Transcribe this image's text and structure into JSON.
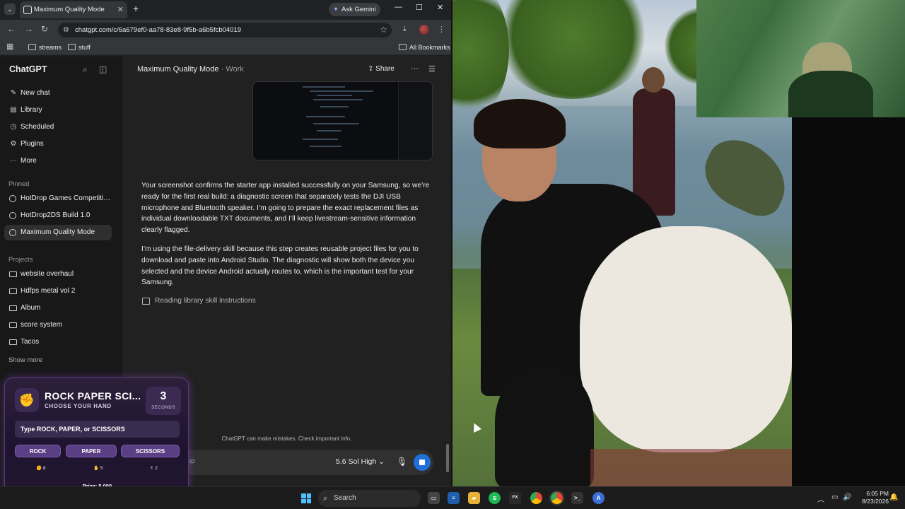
{
  "browser": {
    "tab_title": "Maximum Quality Mode",
    "gemini_label": "Ask Gemini",
    "url": "chatgpt.com/c/6a679ef0-aa78-83e8-9f5b-a6b5fcb04019",
    "bookmarks": [
      "streams",
      "stuff"
    ],
    "all_bookmarks": "All Bookmarks"
  },
  "sidebar": {
    "brand": "ChatGPT",
    "nav": [
      "New chat",
      "Library",
      "Scheduled",
      "Plugins",
      "More"
    ],
    "pinned_heading": "Pinned",
    "pinned": [
      "HotDrop Games Competitio...",
      "HotDrop2DS Build 1.0",
      "Maximum Quality Mode"
    ],
    "projects_heading": "Projects",
    "projects": [
      "website overhaul",
      "Hdfps metal vol 2",
      "Album",
      "score system",
      "Tacos"
    ],
    "show_more": "Show more"
  },
  "chat": {
    "title": "Maximum Quality Mode",
    "separator": "·",
    "project": "Work",
    "share": "Share",
    "message_1": "Your screenshot confirms the starter app installed successfully on your Samsung, so we’re ready for the first real build: a diagnostic screen that separately tests the DJI USB microphone and Bluetooth speaker. I’m going to prepare the exact replacement files as individual downloadable TXT documents, and I’ll keep livestream-sensitive information clearly flagged.",
    "message_2": "I’m using the file-delivery skill because this step creates reusable project files for you to download and paste into Android Studio. The diagnostic will show both the device you selected and the device Android actually routes to, which is the important test for your Samsung.",
    "tool_status": "Reading library skill instructions",
    "disclaimer": "ChatGPT can make mistakes. Check important info.",
    "composer_placeholder": "Follow up",
    "model": "5.6 Sol High"
  },
  "game": {
    "title": "ROCK PAPER SCI...",
    "subtitle": "CHOOSE YOUR HAND",
    "timer_value": "3",
    "timer_unit": "SECONDS",
    "input_prompt": "Type ROCK, PAPER, or SCISSORS",
    "buttons": [
      "ROCK",
      "PAPER",
      "SCISSORS"
    ],
    "counts": [
      "8",
      "5",
      "2"
    ],
    "prize": "Prize: 5,000",
    "progress": 0.1
  },
  "taskbar": {
    "search": "Search",
    "time": "6:05 PM",
    "date": "8/23/2026"
  },
  "colors": {
    "accent": "#1e6fd9",
    "game_accent": "#c46bff",
    "windows_blue": "#4cc2ff"
  }
}
